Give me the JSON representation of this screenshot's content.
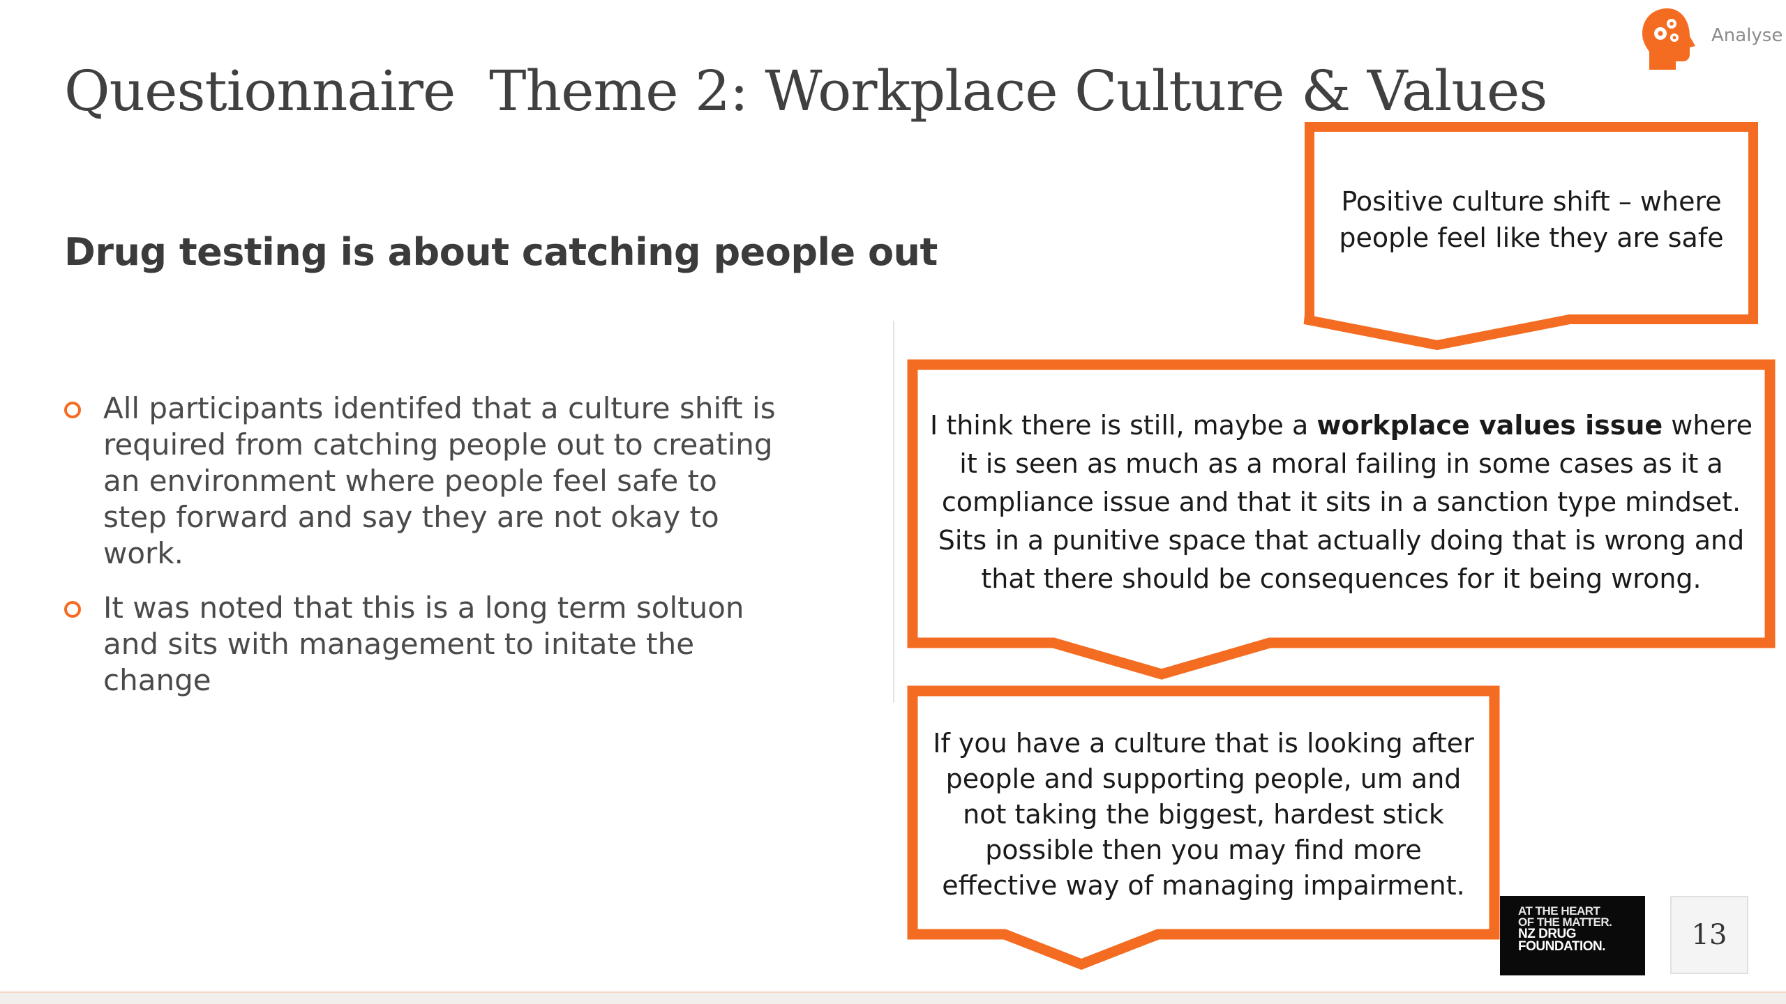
{
  "header": {
    "brand_label": "Analyse",
    "brand_icon": "head-gears-icon",
    "title": "Questionnaire  Theme 2: Workplace Culture & Values"
  },
  "main": {
    "subtitle": "Drug testing is about catching people out",
    "bullets": [
      {
        "text": "All participants identifed that a culture shift is required from catching people out to creating an environment where people feel safe to step forward and say they are not okay to work."
      },
      {
        "text": "It was noted that this is a long term soltuon and sits with management to initate the change"
      }
    ]
  },
  "callouts": [
    {
      "text": "Positive culture shift – where people feel like they are safe"
    },
    {
      "text_before": "I think there is still, maybe a ",
      "text_bold": "workplace values issue",
      "text_after": " where it is seen as much as a moral failing in some cases as it a compliance issue and that it sits in a sanction type mindset. Sits in a punitive space that actually doing that is wrong and that there should be consequences for it being wrong."
    },
    {
      "text": "If you have a culture that is looking after people and supporting people, um and not taking the biggest, hardest stick possible then you may find more effective way of managing impairment."
    }
  ],
  "footer": {
    "logo_lines": [
      "AT THE HEART",
      "OF THE MATTER.",
      "NZ DRUG",
      "FOUNDATION."
    ],
    "page_number": "13"
  },
  "colors": {
    "accent": "#f36c21",
    "title_text": "#404040",
    "body_text": "#4a4a4a",
    "logo_bg": "#0a0a0a"
  }
}
